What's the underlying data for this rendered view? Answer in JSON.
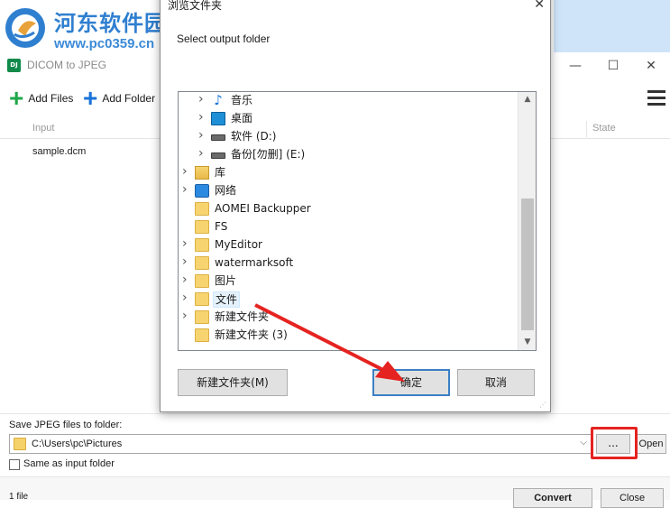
{
  "watermark": {
    "title": "河东软件园",
    "url": "www.pc0359.cn"
  },
  "app": {
    "icon_text": "DJ",
    "title": "DICOM to JPEG",
    "window_controls": [
      "—",
      "☐",
      "✕"
    ],
    "toolbar": {
      "add_files_label": "Add Files",
      "add_folder_label": "Add Folder",
      "menu_icon": "hamburger-icon"
    },
    "table": {
      "columns": [
        "Input",
        "State"
      ],
      "rows": [
        {
          "input": "sample.dcm",
          "state": ""
        }
      ]
    },
    "save": {
      "label": "Save JPEG files to folder:",
      "path": "C:\\Users\\pc\\Pictures",
      "browse_label": "...",
      "open_label": "Open",
      "same_as_input_label": "Same as input folder",
      "same_as_input_checked": false
    },
    "status": {
      "file_count": "1 file",
      "convert_label": "Convert",
      "close_label": "Close"
    }
  },
  "dialog": {
    "title": "浏览文件夹",
    "close_glyph": "✕",
    "prompt": "Select output folder",
    "tree": [
      {
        "label": "音乐",
        "icon": "music-icon",
        "expandable": true
      },
      {
        "label": "桌面",
        "icon": "desktop-icon",
        "expandable": true
      },
      {
        "label": "软件 (D:)",
        "icon": "drive-icon",
        "expandable": true
      },
      {
        "label": "备份[勿删] (E:)",
        "icon": "drive-icon",
        "expandable": true
      },
      {
        "label": "库",
        "icon": "library-icon",
        "expandable": true
      },
      {
        "label": "网络",
        "icon": "network-icon",
        "expandable": true
      },
      {
        "label": "AOMEI Backupper",
        "icon": "folder-icon",
        "expandable": false
      },
      {
        "label": "FS",
        "icon": "folder-icon",
        "expandable": false
      },
      {
        "label": "MyEditor",
        "icon": "folder-icon",
        "expandable": true
      },
      {
        "label": "watermarksoft",
        "icon": "folder-icon",
        "expandable": true
      },
      {
        "label": "图片",
        "icon": "folder-icon",
        "expandable": true
      },
      {
        "label": "文件",
        "icon": "folder-icon",
        "expandable": true,
        "selected": true
      },
      {
        "label": "新建文件夹",
        "icon": "folder-icon",
        "expandable": true
      },
      {
        "label": "新建文件夹 (3)",
        "icon": "folder-icon",
        "expandable": false
      }
    ],
    "buttons": {
      "new_folder": "新建文件夹(M)",
      "ok": "确定",
      "cancel": "取消"
    }
  },
  "colors": {
    "accent_blue": "#1a73d9",
    "add_green": "#1ea84a",
    "annotation_red": "#e52320",
    "watermark_blue": "#2f7fd0"
  }
}
